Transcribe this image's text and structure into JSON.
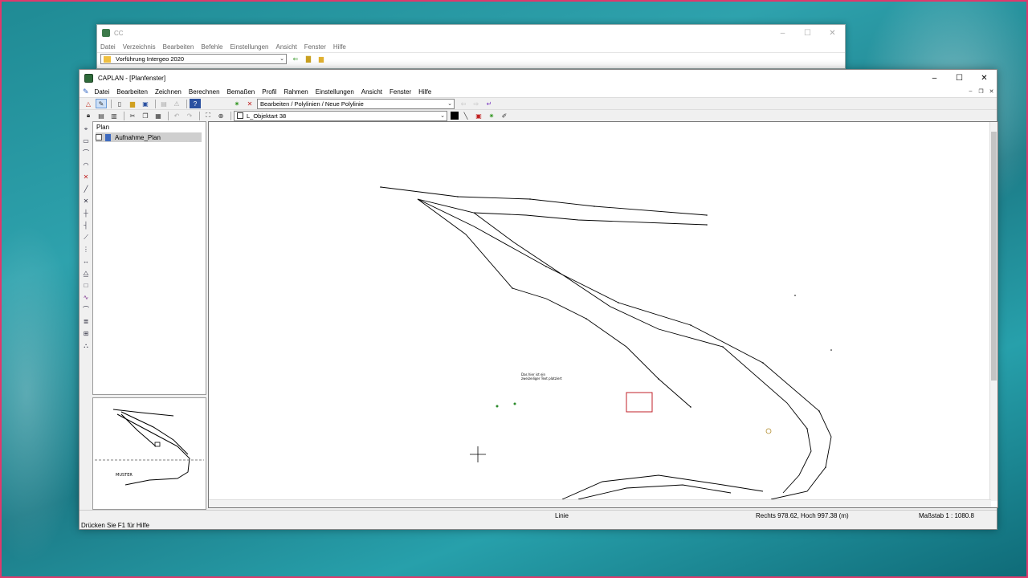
{
  "back_window": {
    "title": "CC",
    "menu": [
      "Datei",
      "Verzeichnis",
      "Bearbeiten",
      "Befehle",
      "Einstellungen",
      "Ansicht",
      "Fenster",
      "Hilfe"
    ],
    "project_select": "Vorführung Intergeo 2020"
  },
  "main_window": {
    "title": "CAPLAN - [Planfenster]",
    "menu": [
      "Datei",
      "Bearbeiten",
      "Zeichnen",
      "Berechnen",
      "Bemaßen",
      "Profil",
      "Rahmen",
      "Einstellungen",
      "Ansicht",
      "Fenster",
      "Hilfe"
    ],
    "command_select": "Bearbeiten / Polylinien / Neue Polylinie",
    "object_select": "L_Objektart 38"
  },
  "tree": {
    "header": "Plan",
    "items": [
      "Aufnahme_Plan"
    ]
  },
  "canvas": {
    "note_line1": "Das hier ist ein",
    "note_line2": "zweizeiliger Text platziert"
  },
  "status": {
    "mode": "Linie",
    "coords": "Rechts 978.62, Hoch 997.38 (m)",
    "scale": "Maßstab 1 : 1080.8",
    "hint": "Drücken Sie F1 für Hilfe"
  },
  "colors": {
    "accent": "#e0396c",
    "selection": "#c0202a"
  }
}
